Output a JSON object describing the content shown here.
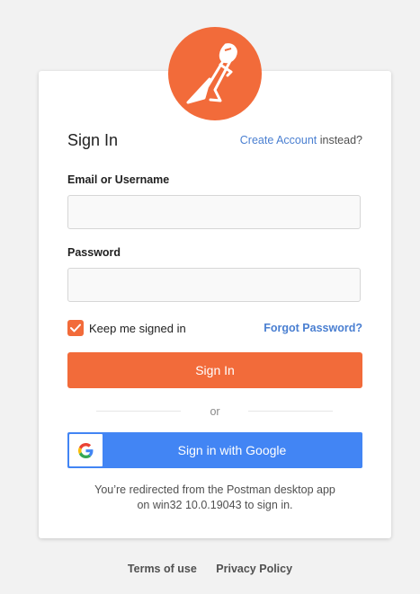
{
  "brand": {
    "icon": "postman-astronaut-icon",
    "color": "#f26b3a"
  },
  "signin": {
    "title": "Sign In",
    "create_link": "Create Account",
    "create_suffix": "instead?",
    "email_label": "Email or Username",
    "email_value": "",
    "password_label": "Password",
    "password_value": "",
    "keep_signed_in_label": "Keep me signed in",
    "keep_signed_in_checked": true,
    "forgot_link": "Forgot Password?",
    "submit_label": "Sign In",
    "divider_text": "or",
    "google_label": "Sign in with Google",
    "google_icon": "google-g-icon",
    "redirect_line1": "You’re redirected from the Postman desktop app",
    "redirect_line2": "on win32 10.0.19043 to sign in."
  },
  "footer": {
    "terms": "Terms of use",
    "privacy": "Privacy Policy"
  },
  "colors": {
    "accent": "#f26b3a",
    "link": "#4a7fd1",
    "google": "#4285f4"
  }
}
